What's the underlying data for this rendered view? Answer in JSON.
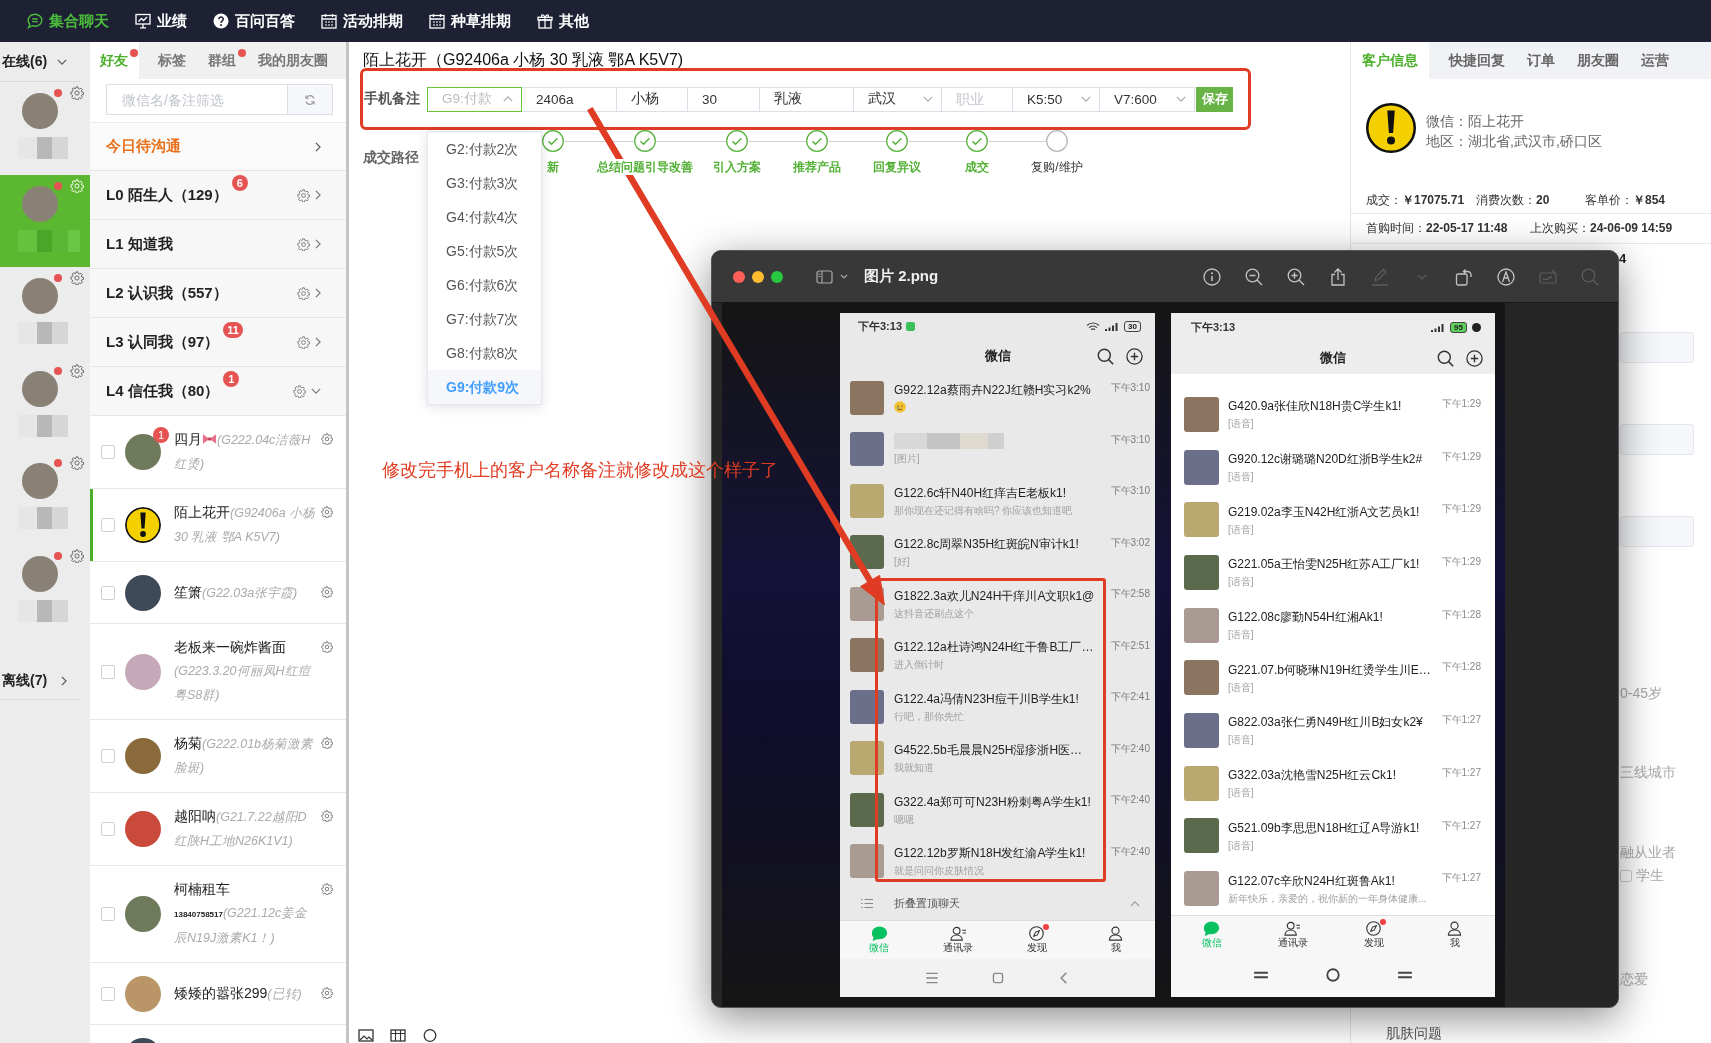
{
  "top_nav": {
    "items": [
      {
        "label": "集合聊天",
        "selected": true
      },
      {
        "label": "业绩",
        "selected": false
      },
      {
        "label": "百问百答",
        "selected": false
      },
      {
        "label": "活动排期",
        "selected": false
      },
      {
        "label": "种草排期",
        "selected": false
      },
      {
        "label": "其他",
        "selected": false
      }
    ]
  },
  "accounts_panel": {
    "online_header": {
      "label": "在线(6)",
      "expanded": true
    },
    "accounts": [
      {
        "selected": false,
        "unread": true
      },
      {
        "selected": true,
        "unread": true
      },
      {
        "selected": false,
        "unread": true
      },
      {
        "selected": false,
        "unread": true
      },
      {
        "selected": false,
        "unread": true
      },
      {
        "selected": false,
        "unread": true
      }
    ],
    "offline_header": {
      "label": "离线(7)",
      "expanded": false
    }
  },
  "friends_panel": {
    "tabs": [
      {
        "label": "好友",
        "selected": true,
        "unread": true
      },
      {
        "label": "标签",
        "selected": false,
        "unread": false
      },
      {
        "label": "群组",
        "selected": false,
        "unread": true
      },
      {
        "label": "我的朋友圈",
        "selected": false,
        "unread": false
      }
    ],
    "search": {
      "placeholder": "微信名/备注筛选"
    },
    "today_row": {
      "label": "今日待沟通"
    },
    "groups": [
      {
        "label": "L0 陌生人（129）",
        "badge": "6",
        "expanded": false
      },
      {
        "label": "L1 知道我",
        "expanded": false
      },
      {
        "label": "L2 认识我（557）",
        "expanded": false
      },
      {
        "label": "L3 认同我（97）",
        "badge": "11",
        "expanded": false
      },
      {
        "label": "L4 信任我（80）",
        "badge": "1",
        "expanded": true,
        "children": [
          {
            "kind": "photo",
            "name": "四月",
            "name_icon": true,
            "note": "(G222.04c洁薇H红烫)",
            "badge": "1",
            "checked": false,
            "selected": false
          },
          {
            "kind": "notice",
            "name": "陌上花开",
            "note": "(G92406a 小杨 30 乳液 鄂A K5V7)",
            "checked": false,
            "selected": true
          },
          {
            "kind": "photo",
            "name": "笙箫",
            "note": "(G22.03a张宇霞)",
            "checked": false,
            "selected": false
          },
          {
            "kind": "photo",
            "name": "老板来一碗炸酱面",
            "note": "(G223.3.20何丽凤H红痘粤S8群)",
            "checked": false,
            "selected": false
          },
          {
            "kind": "photo",
            "name": "杨菊",
            "note": "(G222.01b杨菊激素脸斑)",
            "checked": false,
            "selected": false
          },
          {
            "kind": "photo",
            "name": "越阳呐",
            "note": "(G21.7.22越阳D红陕H工地N26K1V1)",
            "checked": false,
            "selected": false
          },
          {
            "kind": "photo",
            "name": "柯楠租车",
            "phone": "13840758517",
            "note": "(G221.12c姜金辰N19J激素K1！)",
            "checked": false,
            "selected": false
          },
          {
            "kind": "photo",
            "name": "矮矮的嚣张299",
            "note": "(已转)",
            "checked": false,
            "selected": false
          },
          {
            "kind": "photo",
            "selected": false
          }
        ]
      }
    ]
  },
  "chat": {
    "title": "陌上花开（G92406a 小杨 30 乳液 鄂A K5V7)",
    "remark_form": {
      "highlighted": true,
      "label": "手机备注",
      "fields": [
        {
          "kind": "select",
          "value": "G9:付款",
          "expanded": true,
          "options": [
            {
              "label": "G2:付款2次",
              "selected": false
            },
            {
              "label": "G3:付款3次",
              "selected": false
            },
            {
              "label": "G4:付款4次",
              "selected": false
            },
            {
              "label": "G5:付款5次",
              "selected": false
            },
            {
              "label": "G6:付款6次",
              "selected": false
            },
            {
              "label": "G7:付款7次",
              "selected": false
            },
            {
              "label": "G8:付款8次",
              "selected": false
            },
            {
              "label": "G9:付款9次",
              "selected": true
            }
          ]
        },
        {
          "kind": "input",
          "value": "2406a"
        },
        {
          "kind": "input",
          "value": "小杨"
        },
        {
          "kind": "input",
          "value": "30"
        },
        {
          "kind": "input",
          "value": "乳液"
        },
        {
          "kind": "select",
          "value": "武汉",
          "expanded": false
        },
        {
          "kind": "input",
          "placeholder": "职业"
        },
        {
          "kind": "select",
          "value": "K5:50",
          "expanded": false
        },
        {
          "kind": "select",
          "value": "V7:600",
          "expanded": false
        }
      ],
      "save_label": "保存"
    },
    "deal_path": {
      "label": "成交路径",
      "steps": [
        {
          "label": "新",
          "done": true
        },
        {
          "label": "总结问题引导改善",
          "done": true
        },
        {
          "label": "引入方案",
          "done": true
        },
        {
          "label": "推荐产品",
          "done": true
        },
        {
          "label": "回复异议",
          "done": true
        },
        {
          "label": "成交",
          "done": true
        },
        {
          "label": "复购/维护",
          "done": false
        }
      ]
    },
    "annotation": "修改完手机上的客户名称备注就修改成这个样子了"
  },
  "customer_panel": {
    "tabs": [
      {
        "label": "客户信息",
        "selected": true
      },
      {
        "label": "快捷回复",
        "selected": false
      },
      {
        "label": "订单",
        "selected": false
      },
      {
        "label": "朋友圈",
        "selected": false
      },
      {
        "label": "运营",
        "selected": false
      }
    ],
    "wechat": "微信：陌上花开",
    "region": "地区：湖北省,武汉市,硚口区",
    "stats": [
      "成交：**￥17075.71**",
      "消费次数：**20**",
      "客单价：**￥854**"
    ],
    "times": [
      "首购时间：**22-05-17 11:48**",
      "上次购买：**24-06-09 14:59**"
    ],
    "row_3": "4",
    "profile_fields": [
      {
        "kind": "input"
      },
      {
        "kind": "input"
      },
      {
        "kind": "input"
      }
    ],
    "profile_items": [
      {
        "kind": "text",
        "text": "0-45岁"
      },
      {
        "kind": "text",
        "text": "三线城市"
      },
      {
        "kind": "text",
        "text": "融从业者"
      },
      {
        "kind": "checkbox",
        "text": "学生",
        "checked": false
      },
      {
        "kind": "text",
        "text": "恋爱"
      }
    ],
    "section_title": "肌肤问题"
  },
  "preview_window": {
    "title": "图片 2.png",
    "tools": [
      {
        "disabled": false
      },
      {
        "disabled": false
      },
      {
        "disabled": false
      },
      {
        "disabled": false
      },
      {
        "disabled": true
      },
      {
        "disabled": true
      },
      {
        "disabled": false
      },
      {
        "disabled": false
      },
      {
        "disabled": true
      },
      {
        "disabled": true
      }
    ],
    "phones": [
      {
        "kind": "grey",
        "status_time": "下午3:13",
        "battery": "30",
        "title": "微信",
        "chats": [
          {
            "kind": "emoji",
            "name": "G922.12a蔡雨卉N22J红赣H实习k2%",
            "time": "下午3:10",
            "boxed": false
          },
          {
            "kind": "redacted",
            "preview": "[图片]",
            "time": "下午3:10",
            "boxed": false
          },
          {
            "kind": "text",
            "name": "G122.6c轩N40H红痒吉E老板k1!",
            "preview": "那你现在还记得有啥吗? 你应该也知道吧",
            "time": "下午3:10",
            "boxed": false
          },
          {
            "kind": "text",
            "name": "G122.8c周翠N35H红斑皖N审计k1!",
            "preview": "[好]",
            "time": "下午3:02",
            "boxed": false
          },
          {
            "kind": "text",
            "name": "G1822.3a欢儿N24H干痒川A文职k1@",
            "preview": "这抖音还刷点这个",
            "time": "下午2:58",
            "boxed": true
          },
          {
            "kind": "text",
            "name": "G122.12a杜诗鸿N24H红干鲁B工厂…",
            "preview": "进入倒计时",
            "time": "下午2:51",
            "boxed": true
          },
          {
            "kind": "text",
            "name": "G122.4a冯倩N23H痘干川B学生k1!",
            "preview": "行吧，那你先忙",
            "time": "下午2:41",
            "boxed": true
          },
          {
            "kind": "text",
            "name": "G4522.5b毛晨晨N25H湿疹浙H医…",
            "preview": "我就知道",
            "time": "下午2:40",
            "boxed": true
          },
          {
            "kind": "text",
            "name": "G322.4a郑可可N23H粉刺粤A学生k1!",
            "preview": "嗯嗯",
            "time": "下午2:40",
            "boxed": true
          },
          {
            "kind": "text",
            "name": "G122.12b罗斯N18H发红渝A学生k1!",
            "preview": "就是问问你皮肤情况",
            "time": "下午2:40",
            "boxed": true
          }
        ],
        "folded_label": "折叠置顶聊天",
        "tabs": [
          {
            "label": "微信",
            "selected": true,
            "unread": false
          },
          {
            "label": "通讯录",
            "selected": false,
            "unread": false
          },
          {
            "label": "发现",
            "selected": false,
            "unread": true
          },
          {
            "label": "我",
            "selected": false,
            "unread": false
          }
        ]
      },
      {
        "kind": "white",
        "status_time": "下午3:13",
        "battery": "95",
        "title": "微信",
        "chats": [
          {
            "kind": "text",
            "name": "G420.9a张佳欣N18H贵C学生k1!",
            "preview": "[语音]",
            "time": "下午1:29"
          },
          {
            "kind": "text",
            "name": "G920.12c谢璐璐N20D红浙B学生k2#",
            "preview": "[语音]",
            "time": "下午1:29"
          },
          {
            "kind": "text",
            "name": "G219.02a李玉N42H红浙A文艺员k1!",
            "preview": "[语音]",
            "time": "下午1:29"
          },
          {
            "kind": "text",
            "name": "G221.05a王怡雯N25H红苏A工厂k1!",
            "preview": "[语音]",
            "time": "下午1:29"
          },
          {
            "kind": "text",
            "name": "G122.08c廖勤N54H红湘Ak1!",
            "preview": "[语音]",
            "time": "下午1:28"
          },
          {
            "kind": "text",
            "name": "G221.07.b何晓琳N19H红烫学生川E…",
            "preview": "[语音]",
            "time": "下午1:28"
          },
          {
            "kind": "text",
            "name": "G822.03a张仁勇N49H红川B妇女k2¥",
            "preview": "[语音]",
            "time": "下午1:27"
          },
          {
            "kind": "text",
            "name": "G322.03a沈艳雪N25H红云Ck1!",
            "preview": "[语音]",
            "time": "下午1:27"
          },
          {
            "kind": "text",
            "name": "G521.09b李思思N18H红辽A导游k1!",
            "preview": "[语音]",
            "time": "下午1:27"
          },
          {
            "kind": "text",
            "name": "G122.07c辛欣N24H红斑鲁Ak1!",
            "preview": "新年快乐，亲爱的，祝你新的一年身体健康...",
            "time": "下午1:27"
          }
        ],
        "tabs": [
          {
            "label": "微信",
            "selected": true,
            "unread": false
          },
          {
            "label": "通讯录",
            "selected": false,
            "unread": false
          },
          {
            "label": "发现",
            "selected": false,
            "unread": true
          },
          {
            "label": "我",
            "selected": false,
            "unread": false
          }
        ]
      }
    ]
  }
}
